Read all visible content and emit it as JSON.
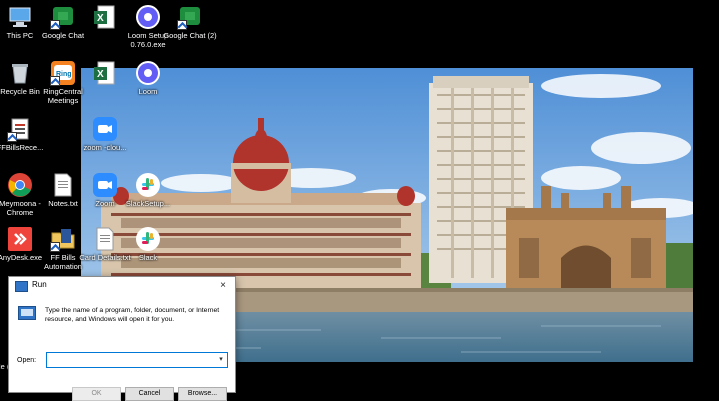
{
  "desktop": {
    "icons": [
      {
        "label": "This PC",
        "icon": "this-pc-icon"
      },
      {
        "label": "Google Chat",
        "icon": "google-chat-icon"
      },
      {
        "label": "",
        "icon": "excel-icon"
      },
      {
        "label": "Loom Setup 0.76.0.exe",
        "icon": "loom-icon"
      },
      {
        "label": "Google Chat (2)",
        "icon": "google-chat-icon"
      },
      {
        "label": "Recycle Bin",
        "icon": "recycle-bin-icon"
      },
      {
        "label": "RingCentral Meetings",
        "icon": "ringcentral-icon"
      },
      {
        "label": "",
        "icon": "excel-icon"
      },
      {
        "label": "Loom",
        "icon": "loom-icon"
      },
      {
        "label": "FFBillsRece...",
        "icon": "document-icon"
      },
      {
        "label": "zoom -clou...",
        "icon": "zoom-icon"
      },
      {
        "label": "Meymoona - Chrome",
        "icon": "chrome-icon"
      },
      {
        "label": "Notes.txt",
        "icon": "text-file-icon"
      },
      {
        "label": "Zoom",
        "icon": "zoom-icon"
      },
      {
        "label": "SlackSetup...",
        "icon": "slack-icon"
      },
      {
        "label": "AnyDesk.exe",
        "icon": "anydesk-icon"
      },
      {
        "label": "FF Bills Automation",
        "icon": "folder-icon"
      },
      {
        "label": "Card Details.txt",
        "icon": "text-file-icon"
      },
      {
        "label": "Slack",
        "icon": "slack-icon"
      },
      {
        "label": "Ne (D",
        "icon": "document-icon"
      }
    ]
  },
  "run_dialog": {
    "title": "Run",
    "close": "×",
    "description": "Type the name of a program, folder, document, or Internet resource, and Windows will open it for you.",
    "open_label": "Open:",
    "input_value": "",
    "dropdown": "▾",
    "ok": "OK",
    "cancel": "Cancel",
    "browse": "Browse..."
  }
}
